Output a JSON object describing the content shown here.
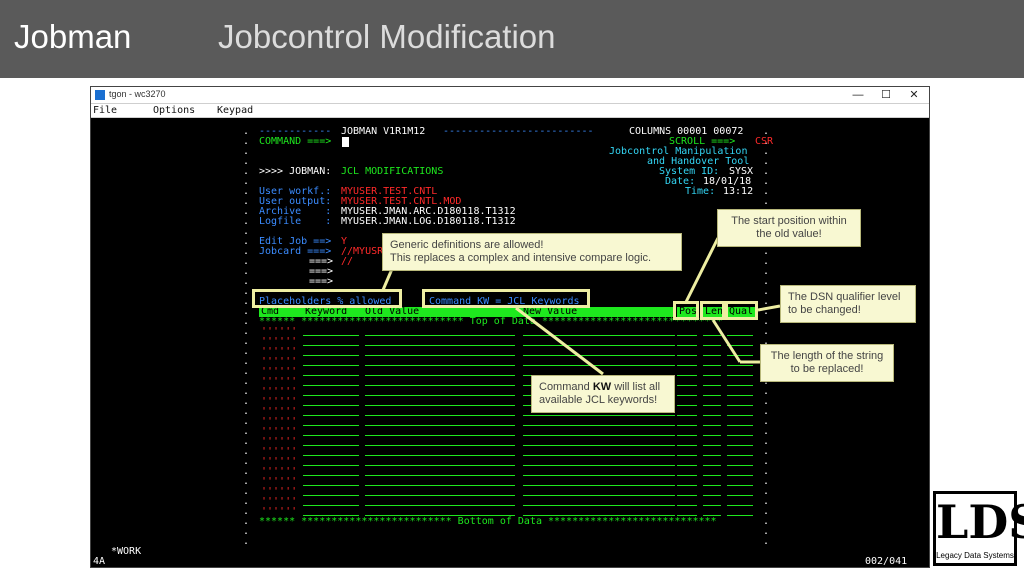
{
  "slide": {
    "title_left": "Jobman",
    "title_right": "Jobcontrol Modification"
  },
  "window": {
    "title": "tgon - wc3270",
    "controls": {
      "minimize": "—",
      "maximize": "☐",
      "close": "✕"
    },
    "menu": [
      "File",
      "Options",
      "Keypad"
    ]
  },
  "terminal": {
    "header_left_rule": "------------",
    "header_title": "JOBMAN V1R1M12",
    "header_right_rule": "-------------------------",
    "columns_label": "COLUMNS 00001 00072",
    "command_label": "COMMAND ===>",
    "scroll_label": "SCROLL ===>",
    "scroll_value": "CSR",
    "tool_line1": "Jobcontrol Manipulation",
    "tool_line2": "and Handover Tool",
    "system_label": "System ID:",
    "system_value": "SYSX",
    "date_label": "Date:",
    "date_value": "18/01/18",
    "time_label": "Time:",
    "time_value": "13:12",
    "jobman_prefix": ">>>> JOBMAN:",
    "jobman_section": "JCL MODIFICATIONS",
    "user_workf_label": "User workf.:",
    "user_workf_value": "MYUSER.TEST.CNTL",
    "user_output_label": "User output:",
    "user_output_value": "MYUSER.TEST.CNTL.MOD",
    "archive_label": "Archive    :",
    "archive_value": "MYUSER.JMAN.ARC.D180118.T1312",
    "logfile_label": "Logfile    :",
    "logfile_value": "MYUSER.JMAN.LOG.D180118.T1312",
    "edit_job_label": "Edit Job ==>",
    "edit_job_value": "Y",
    "jobcard_label": "Jobcard ===>",
    "jobcard_value": "//MYUSR",
    "jobcard_cont_1_label": "===>",
    "jobcard_cont_1_value": "//",
    "jobcard_cont_2_label": "===>",
    "jobcard_cont_3_label": "===>",
    "placeholders": "Placeholders % allowed",
    "command_kw": "Command KW = JCL Keywords",
    "col_cmd": "Cmd",
    "col_keyword": "Keyword",
    "col_old": "Old Value",
    "col_new": "New Value",
    "col_pos": "Pos",
    "col_len": "Len",
    "col_qual": "Qual",
    "row_mark": "''''''",
    "top_line": "****** *************************** Top of Data ******************************",
    "bottom_line": "****** ************************* Bottom of Data ****************************",
    "status_mode": "*WORK",
    "status_left": "4A",
    "status_right": "002/041"
  },
  "callouts": {
    "generic_line1": "Generic definitions are allowed!",
    "generic_line2": "This replaces a complex and intensive compare logic.",
    "start_pos": "The start position within the old value!",
    "dsn_qual": "The DSN qualifier level to be changed!",
    "length": "The length of the string to be replaced!",
    "kw_pre": "Command",
    "kw_bold": "KW",
    "kw_post": "will list all available JCL keywords!"
  },
  "logo": {
    "mark": "LDS",
    "sub": "Legacy Data Systems"
  },
  "colors": {
    "terminal_green": "#1ee81e",
    "terminal_cyan": "#33d6f5",
    "terminal_red": "#ff2a2a",
    "highlight": "#eeeea2",
    "callout_bg": "#f8f8d2"
  }
}
